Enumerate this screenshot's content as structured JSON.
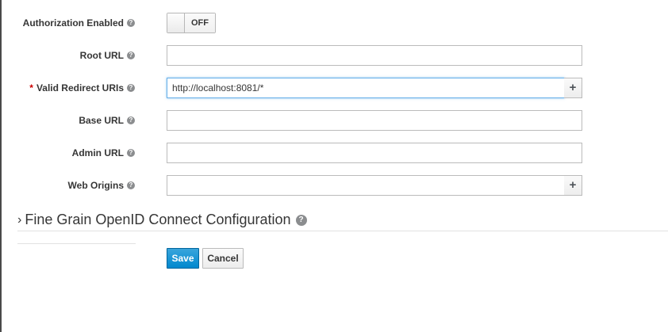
{
  "fields": {
    "authorization": {
      "label": "Authorization Enabled",
      "toggle_state": "OFF"
    },
    "root_url": {
      "label": "Root URL",
      "value": ""
    },
    "redirect_uris": {
      "required_mark": "*",
      "label": "Valid Redirect URIs",
      "value": "http://localhost:8081/*",
      "add_label": "+"
    },
    "base_url": {
      "label": "Base URL",
      "value": ""
    },
    "admin_url": {
      "label": "Admin URL",
      "value": ""
    },
    "web_origins": {
      "label": "Web Origins",
      "value": "",
      "add_label": "+"
    }
  },
  "help_glyph": "?",
  "section": {
    "chevron": "›",
    "title": "Fine Grain OpenID Connect Configuration"
  },
  "actions": {
    "save_label": "Save",
    "cancel_label": "Cancel"
  },
  "colors": {
    "primary": "#0088ce",
    "focus_border": "#66afe9",
    "required": "#cc0000"
  }
}
